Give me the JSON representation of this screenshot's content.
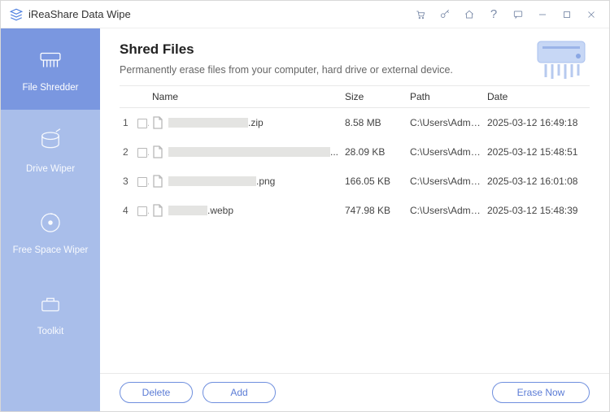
{
  "app": {
    "title": "iReaShare Data Wipe"
  },
  "sidebar": {
    "items": [
      {
        "label": "File Shredder",
        "iconName": "file-shredder-icon"
      },
      {
        "label": "Drive Wiper",
        "iconName": "drive-wiper-icon"
      },
      {
        "label": "Free Space Wiper",
        "iconName": "free-space-wiper-icon"
      },
      {
        "label": "Toolkit",
        "iconName": "toolkit-icon"
      }
    ],
    "activeIndex": 0
  },
  "header": {
    "title": "Shred Files",
    "subtitle": "Permanently erase files from your computer, hard drive or external device."
  },
  "table": {
    "columns": {
      "name": "Name",
      "size": "Size",
      "path": "Path",
      "date": "Date"
    },
    "rows": [
      {
        "index": "1",
        "extension": ".zip",
        "redactWidth": 98,
        "size": "8.58 MB",
        "path": "C:\\Users\\Admi...",
        "date": "2025-03-12 16:49:18"
      },
      {
        "index": "2",
        "extension": "",
        "redactWidth": 210,
        "trailing": "...",
        "size": "28.09 KB",
        "path": "C:\\Users\\Admi...",
        "date": "2025-03-12 15:48:51"
      },
      {
        "index": "3",
        "extension": ".png",
        "redactWidth": 108,
        "size": "166.05 KB",
        "path": "C:\\Users\\Admi...",
        "date": "2025-03-12 16:01:08"
      },
      {
        "index": "4",
        "extension": ".webp",
        "redactWidth": 48,
        "size": "747.98 KB",
        "path": "C:\\Users\\Admi...",
        "date": "2025-03-12 15:48:39"
      }
    ]
  },
  "footer": {
    "delete": "Delete",
    "add": "Add",
    "erase": "Erase Now"
  },
  "titlebarIcons": {
    "cart": "cart-icon",
    "key": "key-icon",
    "home": "home-icon",
    "help": "help-icon",
    "feedback": "feedback-icon",
    "minimize": "minimize-icon",
    "maximize": "maximize-icon",
    "close": "close-icon"
  }
}
